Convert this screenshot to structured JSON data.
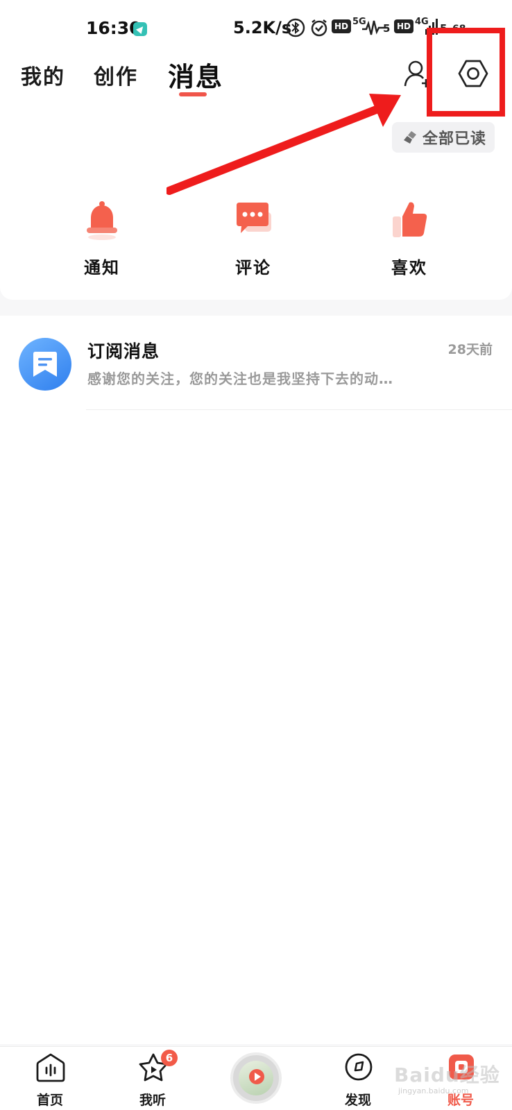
{
  "status_bar": {
    "time": "16:30",
    "network_speed": "5.2K/s",
    "hd1": "HD",
    "sig1": "5G",
    "sig1_num": "5",
    "hd2": "HD",
    "sig2": "4G",
    "sig2_num": "5",
    "battery": "68"
  },
  "header": {
    "tabs": [
      {
        "label": "我的",
        "active": false
      },
      {
        "label": "创作",
        "active": false
      },
      {
        "label": "消息",
        "active": true
      }
    ],
    "accent_color": "#f0554a"
  },
  "read_all_label": "全部已读",
  "shortcuts": [
    {
      "label": "通知",
      "icon": "bell-icon"
    },
    {
      "label": "评论",
      "icon": "comment-icon"
    },
    {
      "label": "喜欢",
      "icon": "thumbs-up-icon"
    }
  ],
  "messages": [
    {
      "title": "订阅消息",
      "time": "28天前",
      "preview": "感谢您的关注，您的关注也是我坚持下去的动…",
      "icon": "subscription-icon"
    }
  ],
  "bottom_nav": {
    "items": [
      {
        "label": "首页",
        "icon": "home-icon"
      },
      {
        "label": "我听",
        "icon": "listen-icon",
        "badge": "6"
      },
      {
        "label": "",
        "icon": "now-playing-disc"
      },
      {
        "label": "发现",
        "icon": "discover-icon"
      },
      {
        "label": "账号",
        "icon": "account-icon",
        "active": true
      }
    ]
  },
  "watermark": {
    "text": "Baidu经验",
    "sub": "jingyan.baidu.com"
  },
  "annotation_color": "#ee1c1c"
}
